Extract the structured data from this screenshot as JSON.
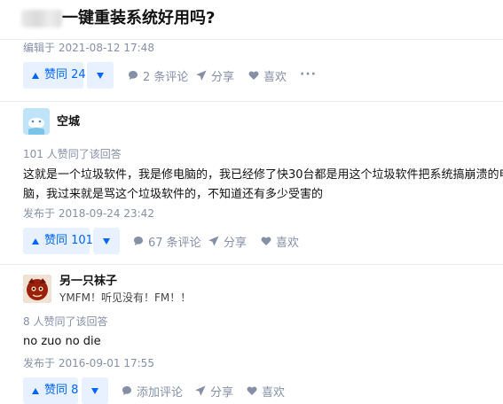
{
  "question": {
    "title": "一键重装系统好用吗?"
  },
  "answers": [
    {
      "edited": "编辑于 2021-08-12 17:48",
      "vote_label": "赞同 24",
      "comments": "2 条评论",
      "share": "分享",
      "like": "喜欢",
      "more": "···"
    },
    {
      "author": "空城",
      "upvote_note": "101 人赞同了该回答",
      "content": [
        "这就是一个垃圾软件，我是修电脑的，我已经修了快30台都是用这个垃圾软件把系统搞崩溃的电",
        "脑，我过来就是骂这个垃圾软件的，不知道还有多少受害的"
      ],
      "published": "发布于 2018-09-24 23:42",
      "vote_label": "赞同 101",
      "comments": "67 条评论",
      "share": "分享",
      "like": "喜欢"
    },
    {
      "author": "另一只袜子",
      "bio": "YMFM！听见没有！FM！！",
      "upvote_note": "8 人赞同了该回答",
      "content": [
        "no zuo no die"
      ],
      "published": "发布于 2016-09-01 17:55",
      "vote_label": "赞同 8",
      "comments": "添加评论",
      "share": "分享",
      "like": "喜欢"
    }
  ],
  "colors": {
    "accent": "#0066ff",
    "vote_bg": "#e8f1ff",
    "meta": "#8590a6"
  },
  "icons": [
    "arrow-up-icon",
    "arrow-down-icon",
    "comment-icon",
    "share-icon",
    "heart-icon",
    "more-icon"
  ]
}
